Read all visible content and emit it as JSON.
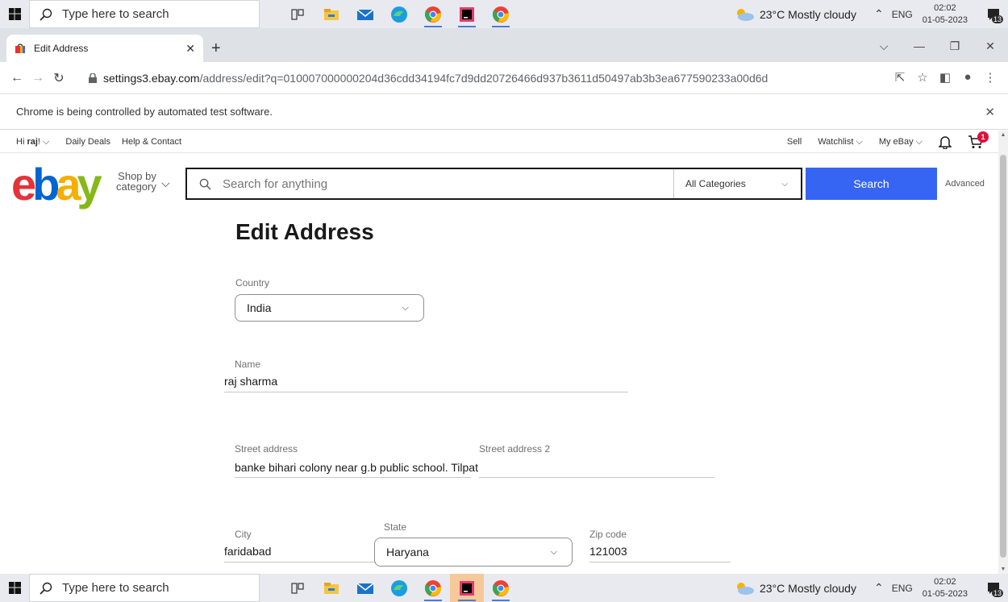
{
  "taskbar": {
    "search_placeholder": "Type here to search",
    "weather": "23°C  Mostly cloudy",
    "lang": "ENG",
    "time": "02:02",
    "date": "01-05-2023",
    "notif_count": "13"
  },
  "browser": {
    "tab_title": "Edit Address",
    "url_host": "settings3.ebay.com",
    "url_path": "/address/edit?q=010007000000204d36cdd34194fc7d9dd20726466d937b3611d50497ab3b3ea677590233a00d6d",
    "infobar_message": "Chrome is being controlled by automated test software."
  },
  "header": {
    "greeting_prefix": "Hi ",
    "user": "raj",
    "greeting_suffix": "! ⌵",
    "daily_deals": "Daily Deals",
    "help": "Help & Contact",
    "sell": "Sell",
    "watchlist": "Watchlist ⌵",
    "my_ebay": "My eBay ⌵",
    "cart_count": "1",
    "shop_by_line1": "Shop by",
    "shop_by_line2": "category",
    "search_placeholder": "Search for anything",
    "category": "All Categories",
    "search_button": "Search",
    "advanced": "Advanced"
  },
  "form": {
    "title": "Edit Address",
    "country_label": "Country",
    "country_value": "India",
    "name_label": "Name",
    "name_value": "raj sharma",
    "street_label": "Street address",
    "street_value": "banke bihari colony near g.b public school. Tilpat",
    "street2_label": "Street address 2",
    "street2_value": "",
    "city_label": "City",
    "city_value": "faridabad",
    "state_label": "State",
    "state_value": "Haryana",
    "zip_label": "Zip code",
    "zip_value": "121003"
  }
}
